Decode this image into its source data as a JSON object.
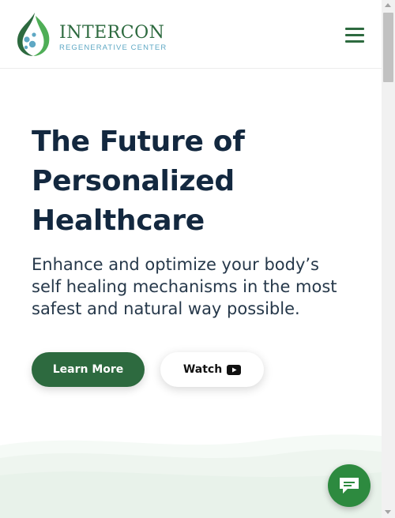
{
  "header": {
    "brand_name": "INTERCON",
    "brand_subtitle": "REGENERATIVE CENTER",
    "logo_icon": "leaf-drop-logo",
    "menu_icon": "hamburger-menu-icon"
  },
  "hero": {
    "title_line1": "The Future of",
    "title_line2": "Personalized",
    "title_line3": "Healthcare",
    "subtitle_line1": "Enhance and optimize your body’s",
    "subtitle_line2": "self healing mechanisms in the most",
    "subtitle_line3": "safest and natural way possible.",
    "learn_more_label": "Learn More",
    "watch_label": "Watch",
    "watch_icon": "youtube-play-icon"
  },
  "chat": {
    "icon": "chat-bubble-icon"
  },
  "colors": {
    "brand_green": "#2d6a3f",
    "title_navy": "#13283f",
    "accent_blue": "#5fa8c4",
    "chat_green": "#2d8a3f",
    "wave_tint": "#eef5ef"
  }
}
